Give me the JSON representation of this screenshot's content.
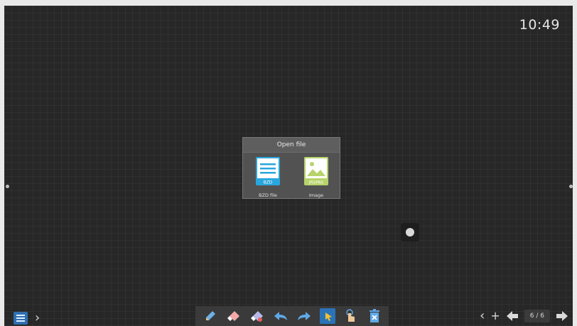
{
  "status": {
    "time": "10:49"
  },
  "dialog": {
    "title": "Open file",
    "options": [
      {
        "label": "BZD file",
        "icon_text": "BZD",
        "icon": "document-icon"
      },
      {
        "label": "Image",
        "icon_text": "JPG/PNG",
        "icon": "image-icon"
      }
    ]
  },
  "toolbar": {
    "tools": [
      "pen-icon",
      "eraser-icon",
      "area-eraser-icon",
      "undo-icon",
      "redo-icon",
      "select-icon",
      "touch-icon",
      "clear-icon"
    ]
  },
  "pager": {
    "page": "6 / 6"
  },
  "colors": {
    "accent": "#2b73b8",
    "board": "#272727",
    "bzd_icon": "#29a6dd",
    "image_icon": "#b7d36b"
  }
}
